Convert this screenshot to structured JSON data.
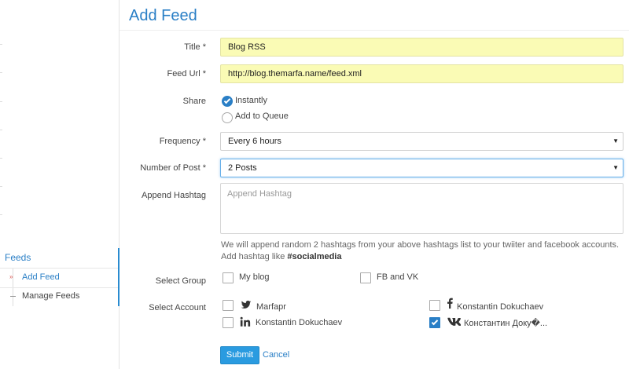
{
  "page": {
    "title": "Add Feed"
  },
  "sidebar": {
    "section_title": "Feeds",
    "items": [
      {
        "label": "Add Feed",
        "active": true
      },
      {
        "label": "Manage Feeds",
        "active": false
      }
    ]
  },
  "form": {
    "title": {
      "label": "Title *",
      "value": "Blog RSS"
    },
    "feed_url": {
      "label": "Feed Url *",
      "value": "http://blog.themarfa.name/feed.xml"
    },
    "share": {
      "label": "Share",
      "options": [
        {
          "label": "Instantly",
          "checked": true
        },
        {
          "label": "Add to Queue",
          "checked": false
        }
      ]
    },
    "frequency": {
      "label": "Frequency *",
      "value": "Every 6 hours"
    },
    "number_of_post": {
      "label": "Number of Post *",
      "value": "2 Posts"
    },
    "append_hashtag": {
      "label": "Append Hashtag",
      "placeholder": "Append Hashtag",
      "help_text": "We will append random 2 hashtags from your above hashtags list to your twiiter and facebook accounts. Add hashtag like ",
      "help_example": "#socialmedia"
    },
    "select_group": {
      "label": "Select Group",
      "options": [
        {
          "label": "My blog",
          "checked": false
        },
        {
          "label": "FB and VK",
          "checked": false
        }
      ]
    },
    "select_account": {
      "label": "Select Account",
      "accounts": [
        {
          "name": "Marfapr",
          "network": "twitter-icon",
          "checked": false
        },
        {
          "name": "Konstantin Dokuchaev",
          "network": "facebook-icon",
          "checked": false
        },
        {
          "name": "Konstantin Dokuchaev",
          "network": "linkedin-icon",
          "checked": false
        },
        {
          "name": "Константин Доку�...",
          "network": "vk-icon",
          "checked": true
        }
      ]
    },
    "submit_label": "Submit",
    "cancel_label": "Cancel"
  },
  "colors": {
    "accent": "#2a7fc6",
    "autofill_bg": "#fafbb5",
    "submit_bg": "#2a9be0"
  }
}
